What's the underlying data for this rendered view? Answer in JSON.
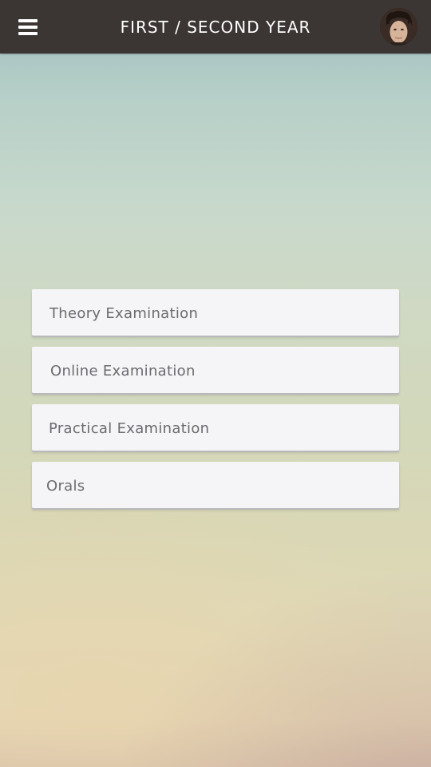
{
  "header": {
    "title": "FIRST / SECOND YEAR",
    "menu_icon": "hamburger-menu-icon",
    "avatar_icon": "user-avatar"
  },
  "menu": {
    "items": [
      {
        "label": "Theory Examination"
      },
      {
        "label": "Online Examination"
      },
      {
        "label": "Practical Examination"
      },
      {
        "label": "Orals"
      }
    ]
  },
  "colors": {
    "topbar": "#3b3634",
    "card_background": "#f5f5f7",
    "card_text": "#6b6b70",
    "title_text": "#ffffff"
  }
}
